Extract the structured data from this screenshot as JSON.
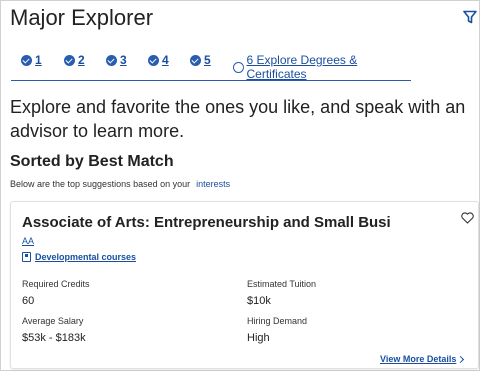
{
  "header": {
    "title": "Major Explorer",
    "filter_icon": "filter-icon"
  },
  "steps": [
    {
      "label": "1",
      "status": "done"
    },
    {
      "label": "2",
      "status": "done"
    },
    {
      "label": "3",
      "status": "done"
    },
    {
      "label": "4",
      "status": "done"
    },
    {
      "label": "5",
      "status": "done"
    },
    {
      "label": "6 Explore Degrees & Certificates",
      "status": "current"
    }
  ],
  "intro": {
    "text": "Explore and favorite the ones you like, and speak with an advisor to learn more."
  },
  "sort": {
    "heading": "Sorted by Best Match",
    "subtext": "Below are the top suggestions based on your",
    "link": "interests"
  },
  "card": {
    "title": "Associate of Arts: Entrepreneurship and Small Busi",
    "code": "AA",
    "dev_link": "Developmental courses",
    "required_credits_label": "Required Credits",
    "required_credits_value": "60",
    "estimated_tuition_label": "Estimated Tuition",
    "estimated_tuition_value": "$10k",
    "average_salary_label": "Average Salary",
    "average_salary_value": "$53k - $183k",
    "hiring_demand_label": "Hiring Demand",
    "hiring_demand_value": "High",
    "more_link": "View More Details"
  },
  "colors": {
    "accent": "#1a4fa0",
    "text": "#222222",
    "border": "#e0e0e0"
  }
}
